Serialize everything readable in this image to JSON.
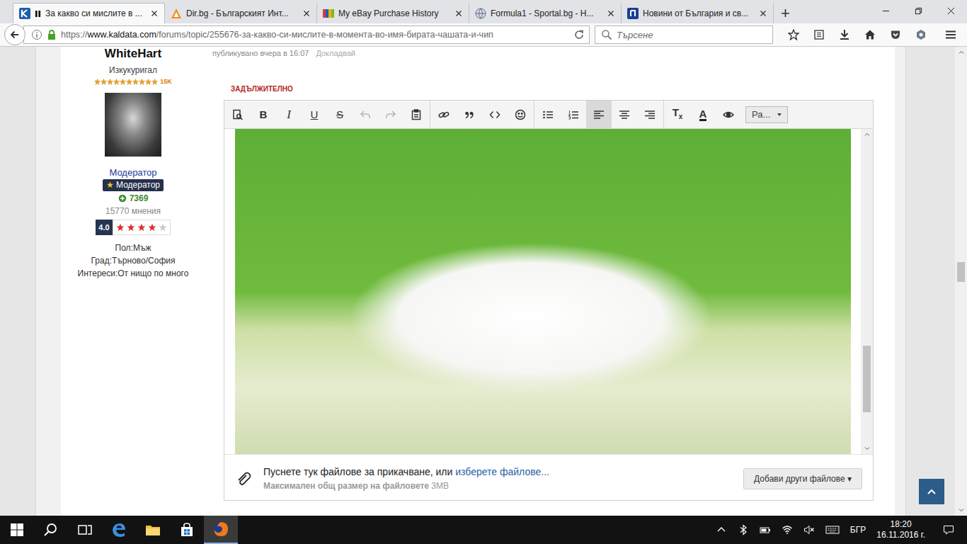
{
  "browser": {
    "tabs": [
      {
        "label": "За какво си мислите в ...",
        "selected": true,
        "audio_playing": true
      },
      {
        "label": "Dir.bg - Българският Инт...",
        "selected": false,
        "audio_playing": false
      },
      {
        "label": "My eBay Purchase History",
        "selected": false,
        "audio_playing": false
      },
      {
        "label": "Formula1 - Sportal.bg - Н...",
        "selected": false,
        "audio_playing": false
      },
      {
        "label": "Новини от България и св...",
        "selected": false,
        "audio_playing": false
      }
    ],
    "new_tab": "+",
    "url": {
      "scheme": "https://",
      "host": "www.kaldata.com",
      "path": "/forums/topic/255676-за-какво-си-мислите-в-момента-во-имя-бирата-чашата-и-чип"
    },
    "search_placeholder": "Търсене"
  },
  "author": {
    "name": "WhiteHart",
    "rank": "Изкукуригал",
    "rank_stars": 10,
    "rank_stars_max": 10,
    "rank_count": "15K",
    "group_link": "Модератор",
    "badge_icon": "★",
    "badge": "Модератор",
    "reputation": "7369",
    "posts": "15770 мнения",
    "rating": "4.0",
    "rating_stars": 4,
    "rating_max": 5,
    "fields": [
      "Пол:Мъж",
      "Град:Търново/София",
      "Интереси:От нищо по много"
    ]
  },
  "post": {
    "meta": "публикувано вчера в 16:07",
    "report": "Докладвай",
    "required_label": "ЗАДЪЛЖИТЕЛНО",
    "editor": {
      "toolbar": [
        [
          {
            "kind": "icon",
            "selected": false,
            "disabled": false
          },
          {
            "kind": "text",
            "label": "B",
            "format": "bold",
            "selected": false,
            "disabled": false
          },
          {
            "kind": "text",
            "label": "I",
            "format": "italic",
            "selected": false,
            "disabled": false
          },
          {
            "kind": "text",
            "label": "U",
            "format": "underline",
            "selected": false,
            "disabled": false
          },
          {
            "kind": "text",
            "label": "S",
            "format": "strike",
            "selected": false,
            "disabled": false
          },
          {
            "kind": "icon",
            "selected": false,
            "disabled": true
          },
          {
            "kind": "icon",
            "selected": false,
            "disabled": true
          },
          {
            "kind": "icon",
            "selected": false,
            "disabled": false
          }
        ],
        [
          {
            "kind": "icon",
            "selected": false,
            "disabled": false
          },
          {
            "kind": "icon",
            "selected": false,
            "disabled": false
          },
          {
            "kind": "icon",
            "selected": false,
            "disabled": false
          },
          {
            "kind": "icon",
            "selected": false,
            "disabled": false
          }
        ],
        [
          {
            "kind": "icon",
            "selected": false,
            "disabled": false
          },
          {
            "kind": "icon",
            "selected": false,
            "disabled": false
          },
          {
            "kind": "icon",
            "selected": true,
            "disabled": false
          },
          {
            "kind": "icon",
            "selected": false,
            "disabled": false
          },
          {
            "kind": "icon",
            "selected": false,
            "disabled": false
          }
        ],
        [
          {
            "kind": "text",
            "label": "T",
            "sub": "x",
            "format": "clear",
            "selected": false,
            "disabled": false
          },
          {
            "kind": "text",
            "label": "A",
            "format": "color",
            "selected": false,
            "disabled": false
          },
          {
            "kind": "icon",
            "selected": false,
            "disabled": false
          },
          {
            "kind": "dropdown",
            "label": "Ра...",
            "selected": false,
            "disabled": false
          }
        ]
      ],
      "scroll": {
        "position": 0.68,
        "size": 0.22
      }
    },
    "attachments": {
      "drop_text": "Пуснете тук файлове за прикачване, или",
      "choose_link": "изберете файлове...",
      "limit_label": "Максимален общ размер на файловете",
      "limit_value": "3MB",
      "add_button": "Добави други файлове",
      "add_button_caret": "▾"
    }
  },
  "page_scroll": {
    "position": 0.457,
    "size": 0.045
  },
  "taskbar": {
    "apps": [
      {
        "selected": false
      },
      {
        "selected": false
      },
      {
        "selected": false
      },
      {
        "selected": true
      }
    ],
    "tray": {
      "volume_muted": true,
      "language": "БГР",
      "time": "18:20",
      "date": "16.11.2016 г."
    }
  }
}
